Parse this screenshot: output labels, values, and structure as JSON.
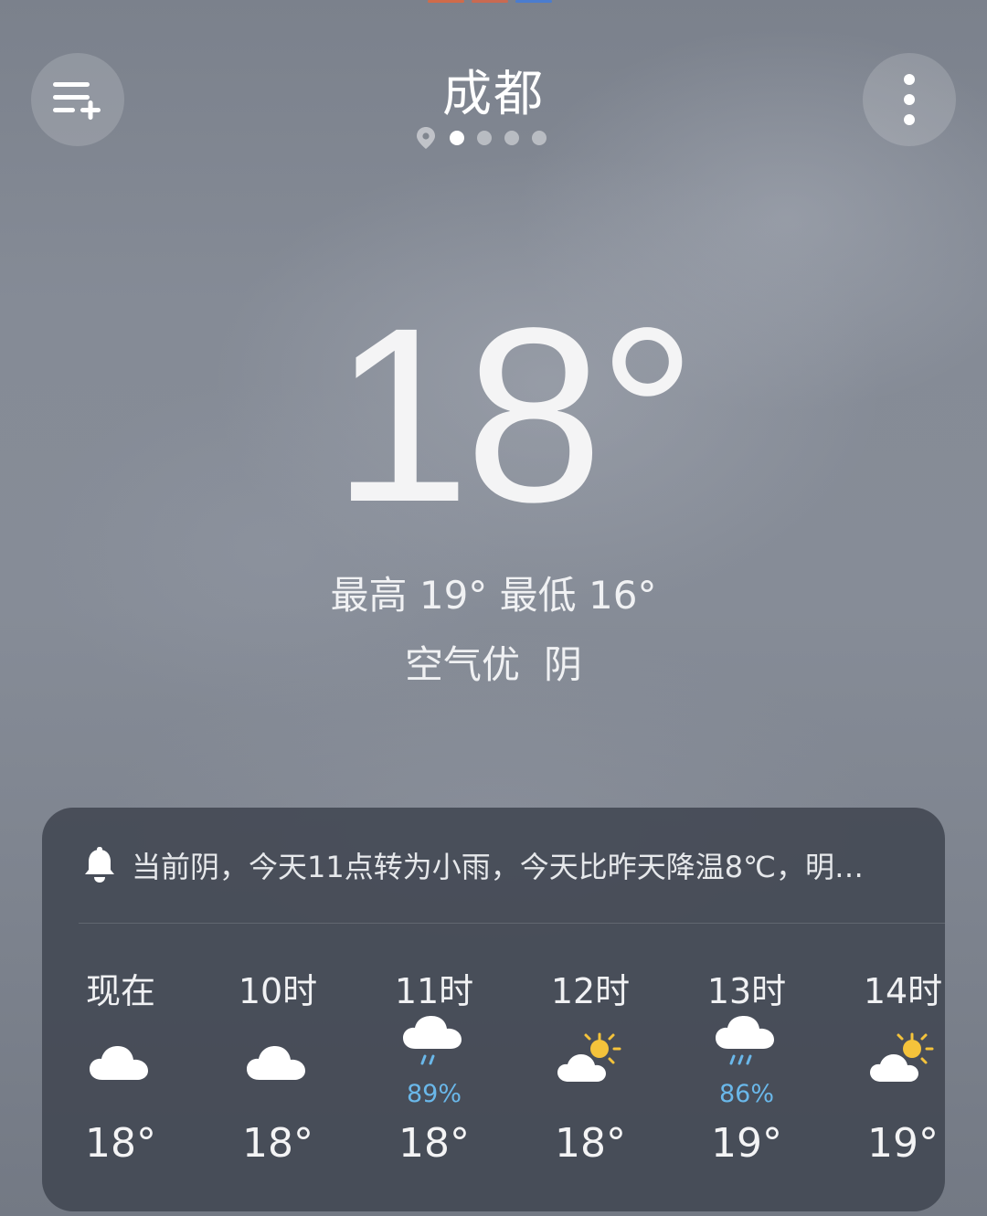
{
  "header": {
    "city": "成都",
    "pager": {
      "count": 4,
      "active_index": 0
    },
    "left_button_icon": "add-city-list-icon",
    "right_button_icon": "more-vertical-icon"
  },
  "current": {
    "temperature": "18°",
    "high_low": "最高 19° 最低 16°",
    "air_quality": "空气优",
    "condition": "阴"
  },
  "forecast_card": {
    "alert_icon": "bell-icon",
    "alert_text": "当前阴，今天11点转为小雨，今天比昨天降温8℃，明…",
    "hourly": [
      {
        "time": "现在",
        "icon": "cloudy-icon",
        "precip": "",
        "temp": "18°"
      },
      {
        "time": "10时",
        "icon": "cloudy-icon",
        "precip": "",
        "temp": "18°"
      },
      {
        "time": "11时",
        "icon": "light-rain-icon",
        "precip": "89%",
        "temp": "18°"
      },
      {
        "time": "12时",
        "icon": "partly-cloudy-icon",
        "precip": "",
        "temp": "18°"
      },
      {
        "time": "13时",
        "icon": "light-rain-icon",
        "precip": "86%",
        "temp": "19°"
      },
      {
        "time": "14时",
        "icon": "partly-cloudy-icon",
        "precip": "",
        "temp": "19°"
      }
    ]
  },
  "colors": {
    "precip_text": "#6ab8ea",
    "sun": "#f5c33b",
    "card_bg": "#424853"
  }
}
